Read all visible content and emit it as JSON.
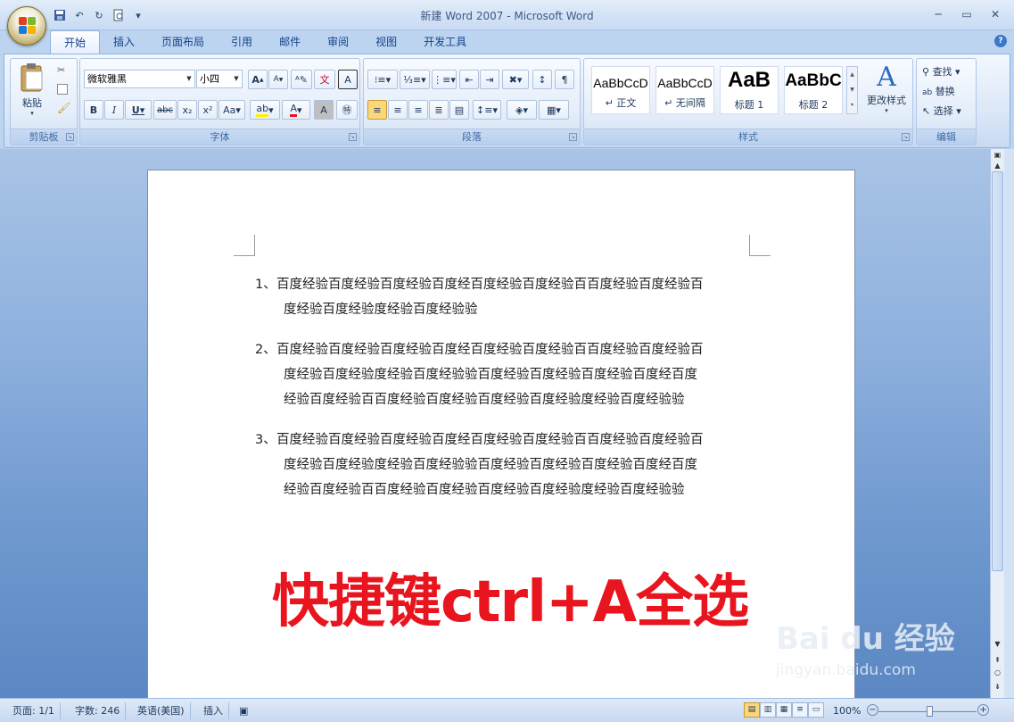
{
  "window": {
    "title": "新建 Word 2007 - Microsoft Word"
  },
  "qat": {
    "items": [
      "save-icon",
      "undo-icon",
      "redo-icon",
      "print-preview-icon",
      "customize-icon"
    ]
  },
  "tabs": [
    "开始",
    "插入",
    "页面布局",
    "引用",
    "邮件",
    "审阅",
    "视图",
    "开发工具"
  ],
  "active_tab": "开始",
  "ribbon": {
    "clipboard": {
      "label": "剪贴板",
      "paste": "粘贴"
    },
    "font": {
      "label": "字体",
      "name": "微软雅黑",
      "size": "小四",
      "grow": "A",
      "shrink": "A",
      "bold": "B",
      "italic": "I",
      "underline": "U",
      "strike": "abc",
      "sub": "x₂",
      "sup": "x²",
      "case": "Aa"
    },
    "paragraph": {
      "label": "段落"
    },
    "styles": {
      "label": "样式",
      "cards": [
        {
          "sample": "AaBbCcD",
          "name": "↵ 正文"
        },
        {
          "sample": "AaBbCcD",
          "name": "↵ 无间隔"
        },
        {
          "sample": "AaB",
          "name": "标题 1"
        },
        {
          "sample": "AaBbC",
          "name": "标题 2"
        }
      ],
      "change": "更改样式"
    },
    "editing": {
      "label": "编辑",
      "find": "查找",
      "replace": "替换",
      "select": "选择"
    }
  },
  "document": {
    "items": [
      {
        "num": "1、",
        "first": "百度经验百度经验百度经验百度经百度经验百度经验百百度经验百度经验百",
        "rest": [
          "度经验百度经验度经验百度经验验"
        ]
      },
      {
        "num": "2、",
        "first": "百度经验百度经验百度经验百度经百度经验百度经验百百度经验百度经验百",
        "rest": [
          "度经验百度经验度经验百度经验验百度经验百度经验百度经验百度经百度",
          "经验百度经验百百度经验百度经验百度经验百度经验度经验百度经验验"
        ]
      },
      {
        "num": "3、",
        "first": "百度经验百度经验百度经验百度经百度经验百度经验百百度经验百度经验百",
        "rest": [
          "度经验百度经验度经验百度经验验百度经验百度经验百度经验百度经百度",
          "经验百度经验百百度经验百度经验百度经验百度经验度经验百度经验验"
        ]
      }
    ],
    "overlay": "快捷键ctrl+A全选"
  },
  "statusbar": {
    "page": "页面: 1/1",
    "words": "字数: 246",
    "lang": "英语(美国)",
    "mode": "插入",
    "zoom": "100%"
  },
  "watermark": {
    "brand": "Bai du 经验",
    "url": "jingyan.baidu.com"
  }
}
